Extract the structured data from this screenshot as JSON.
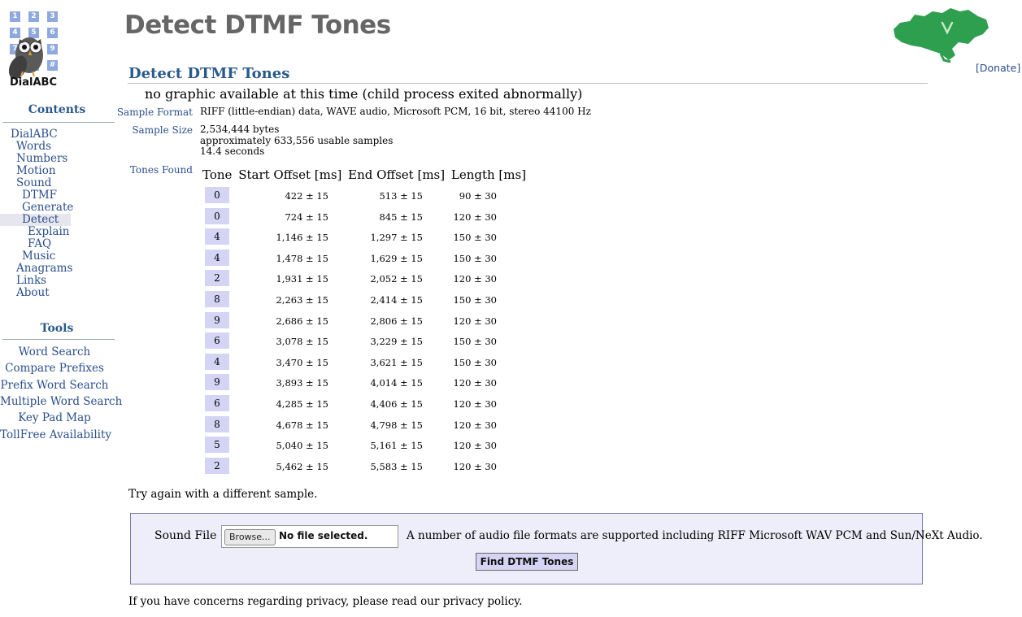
{
  "logo": {
    "keys": [
      "1",
      "2",
      "3",
      "4",
      "5",
      "6",
      "7",
      "8",
      "9",
      "0",
      "#"
    ],
    "text": "DialABC"
  },
  "page_title": "Detect DTMF Tones",
  "donate": "[Donate]",
  "sidebar": {
    "contents_heading": "Contents",
    "nav": [
      {
        "label": "DialABC",
        "level": 0
      },
      {
        "label": "Words",
        "level": 1
      },
      {
        "label": "Numbers",
        "level": 1
      },
      {
        "label": "Motion",
        "level": 1
      },
      {
        "label": "Sound",
        "level": 1
      },
      {
        "label": "DTMF",
        "level": 2
      },
      {
        "label": "Generate",
        "level": 2
      },
      {
        "label": "Detect",
        "level": 2,
        "current": true
      },
      {
        "label": "Explain",
        "level": 3
      },
      {
        "label": "FAQ",
        "level": 3
      },
      {
        "label": "Music",
        "level": 2
      },
      {
        "label": "Anagrams",
        "level": 1
      },
      {
        "label": "Links",
        "level": 1
      },
      {
        "label": "About",
        "level": 1
      }
    ],
    "tools_heading": "Tools",
    "tools": [
      "Word Search",
      "Compare Prefixes",
      "Prefix Word Search",
      "Multiple Word Search",
      "Key Pad Map",
      "TollFree Availability"
    ]
  },
  "section_title": "Detect DTMF Tones",
  "no_graphic": "no graphic available at this time (child process exited abnormally)",
  "properties": {
    "format_label": "Sample Format",
    "format_value": "RIFF (little-endian) data, WAVE audio, Microsoft PCM, 16 bit, stereo 44100 Hz",
    "size_label": "Sample Size",
    "size_lines": [
      "2,534,444 bytes",
      "approximately 633,556 usable samples",
      "14.4 seconds"
    ],
    "tones_label": "Tones Found"
  },
  "tones_table": {
    "headers": [
      "Tone",
      "Start Offset [ms]",
      "End Offset [ms]",
      "Length [ms]"
    ],
    "rows": [
      [
        "0",
        "422 ± 15",
        "513 ± 15",
        "90 ± 30"
      ],
      [
        "0",
        "724 ± 15",
        "845 ± 15",
        "120 ± 30"
      ],
      [
        "4",
        "1,146 ± 15",
        "1,297 ± 15",
        "150 ± 30"
      ],
      [
        "4",
        "1,478 ± 15",
        "1,629 ± 15",
        "150 ± 30"
      ],
      [
        "2",
        "1,931 ± 15",
        "2,052 ± 15",
        "120 ± 30"
      ],
      [
        "8",
        "2,263 ± 15",
        "2,414 ± 15",
        "150 ± 30"
      ],
      [
        "9",
        "2,686 ± 15",
        "2,806 ± 15",
        "120 ± 30"
      ],
      [
        "6",
        "3,078 ± 15",
        "3,229 ± 15",
        "150 ± 30"
      ],
      [
        "4",
        "3,470 ± 15",
        "3,621 ± 15",
        "150 ± 30"
      ],
      [
        "9",
        "3,893 ± 15",
        "4,014 ± 15",
        "120 ± 30"
      ],
      [
        "6",
        "4,285 ± 15",
        "4,406 ± 15",
        "120 ± 30"
      ],
      [
        "8",
        "4,678 ± 15",
        "4,798 ± 15",
        "120 ± 30"
      ],
      [
        "5",
        "5,040 ± 15",
        "5,161 ± 15",
        "120 ± 30"
      ],
      [
        "2",
        "5,462 ± 15",
        "5,583 ± 15",
        "120 ± 30"
      ]
    ]
  },
  "try_again": "Try again with a different sample.",
  "form": {
    "sound_label": "Sound File",
    "browse_label": "Browse...",
    "file_status": "No file selected.",
    "format_note": "A number of audio file formats are supported including RIFF Microsoft WAV PCM and Sun/NeXt Audio.",
    "submit_label": "Find DTMF Tones"
  },
  "privacy": "If you have concerns regarding privacy, please read our privacy policy.",
  "colors": {
    "accent": "#2a5a8c",
    "link": "#2a4e8c",
    "tone_cell": "#d4d4f4",
    "map_green": "#2e9e4f"
  }
}
